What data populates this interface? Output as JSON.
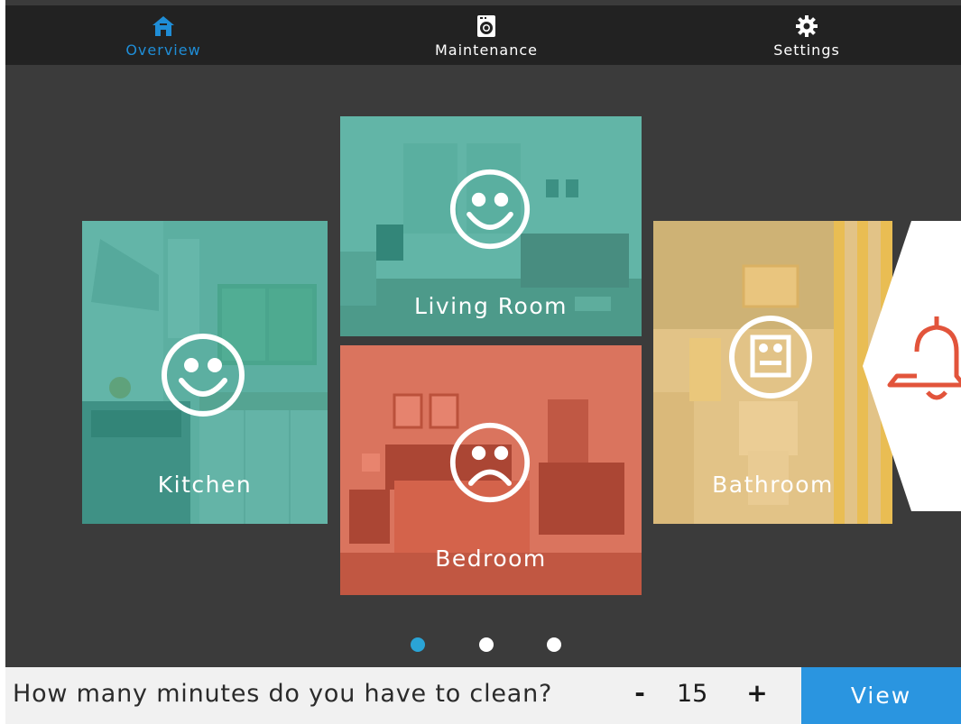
{
  "nav": {
    "tabs": [
      {
        "label": "Overview",
        "icon": "home-icon",
        "active": true
      },
      {
        "label": "Maintenance",
        "icon": "washing-machine-icon",
        "active": false
      },
      {
        "label": "Settings",
        "icon": "gear-icon",
        "active": false
      }
    ],
    "active_color": "#1f8dd6"
  },
  "rooms": [
    {
      "name": "Kitchen",
      "status": "happy",
      "tint": "#2fa08f"
    },
    {
      "name": "Living Room",
      "status": "happy",
      "tint": "#2fa08f"
    },
    {
      "name": "Bedroom",
      "status": "sad",
      "tint": "#e2543b"
    },
    {
      "name": "Bathroom",
      "status": "neutral",
      "tint": "#e5b760"
    }
  ],
  "alert": {
    "icon": "bell-icon",
    "color": "#e2543b"
  },
  "pager": {
    "dots": 3,
    "active_index": 0,
    "active_color": "#2aa4d6"
  },
  "bottom": {
    "question": "How many minutes do you have to clean?",
    "minus_label": "-",
    "minutes": "15",
    "plus_label": "+",
    "view_label": "View"
  }
}
